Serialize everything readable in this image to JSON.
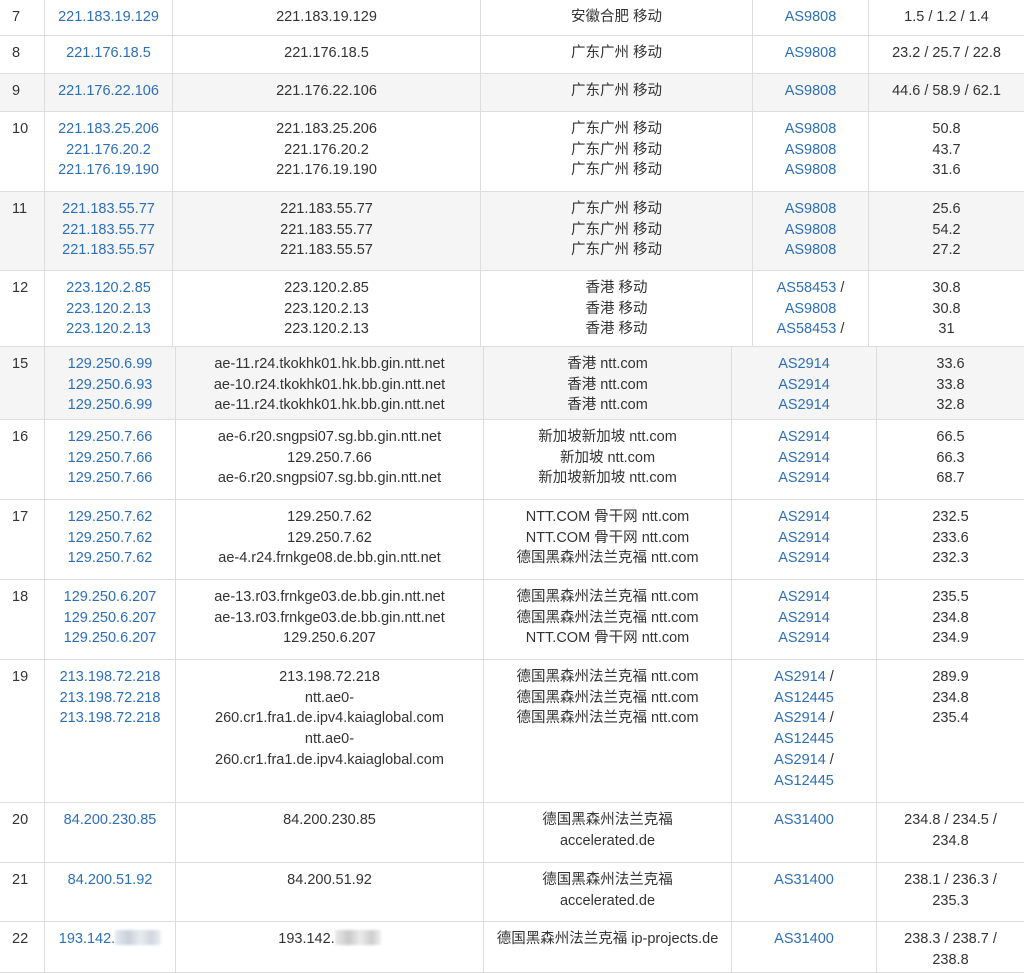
{
  "rows": [
    {
      "hop": "7",
      "ips": [
        "221.183.19.129"
      ],
      "hosts": [
        "221.183.19.129"
      ],
      "locs": [
        "安徽合肥 移动"
      ],
      "asns": [
        {
          "as": "AS9808",
          "sep": ""
        }
      ],
      "rtt": [
        "1.5 / 1.2 / 1.4"
      ]
    },
    {
      "hop": "8",
      "ips": [
        "221.176.18.5"
      ],
      "hosts": [
        "221.176.18.5"
      ],
      "locs": [
        "广东广州 移动"
      ],
      "asns": [
        {
          "as": "AS9808",
          "sep": ""
        }
      ],
      "rtt": [
        "23.2 / 25.7 / 22.8"
      ]
    },
    {
      "hop": "9",
      "ips": [
        "221.176.22.106"
      ],
      "hosts": [
        "221.176.22.106"
      ],
      "locs": [
        "广东广州 移动"
      ],
      "asns": [
        {
          "as": "AS9808",
          "sep": ""
        }
      ],
      "rtt": [
        "44.6 / 58.9 / 62.1"
      ]
    },
    {
      "hop": "10",
      "ips": [
        "221.183.25.206",
        "221.176.20.2",
        "221.176.19.190"
      ],
      "hosts": [
        "221.183.25.206",
        "221.176.20.2",
        "221.176.19.190"
      ],
      "locs": [
        "广东广州 移动",
        "广东广州 移动",
        "广东广州 移动"
      ],
      "asns": [
        {
          "as": "AS9808",
          "sep": ""
        },
        {
          "as": "AS9808",
          "sep": ""
        },
        {
          "as": "AS9808",
          "sep": ""
        }
      ],
      "rtt": [
        "50.8",
        "43.7",
        "31.6"
      ]
    },
    {
      "hop": "11",
      "ips": [
        "221.183.55.77",
        "221.183.55.77",
        "221.183.55.57"
      ],
      "hosts": [
        "221.183.55.77",
        "221.183.55.77",
        "221.183.55.57"
      ],
      "locs": [
        "广东广州 移动",
        "广东广州 移动",
        "广东广州 移动"
      ],
      "asns": [
        {
          "as": "AS9808",
          "sep": ""
        },
        {
          "as": "AS9808",
          "sep": ""
        },
        {
          "as": "AS9808",
          "sep": ""
        }
      ],
      "rtt": [
        "25.6",
        "54.2",
        "27.2"
      ]
    },
    {
      "hop": "12",
      "ips": [
        "223.120.2.85",
        "223.120.2.13",
        "223.120.2.13"
      ],
      "hosts": [
        "223.120.2.85",
        "223.120.2.13",
        "223.120.2.13"
      ],
      "locs": [
        "香港 移动",
        "香港 移动",
        "香港 移动"
      ],
      "asns": [
        {
          "as": "AS58453",
          "sep": " /"
        },
        {
          "as": "AS9808",
          "sep": ""
        },
        {
          "as": "AS58453",
          "sep": " /"
        }
      ],
      "rtt": [
        "30.8",
        "30.8",
        "31"
      ]
    },
    {
      "hop": "15",
      "ips": [
        "129.250.6.99",
        "129.250.6.93",
        "129.250.6.99"
      ],
      "hosts": [
        "ae-11.r24.tkokhk01.hk.bb.gin.ntt.net",
        "ae-10.r24.tkokhk01.hk.bb.gin.ntt.net",
        "ae-11.r24.tkokhk01.hk.bb.gin.ntt.net"
      ],
      "locs": [
        "香港 ntt.com",
        "香港 ntt.com",
        "香港 ntt.com"
      ],
      "asns": [
        {
          "as": "AS2914",
          "sep": ""
        },
        {
          "as": "AS2914",
          "sep": ""
        },
        {
          "as": "AS2914",
          "sep": ""
        }
      ],
      "rtt": [
        "33.6",
        "33.8",
        "32.8"
      ]
    },
    {
      "hop": "16",
      "ips": [
        "129.250.7.66",
        "129.250.7.66",
        "129.250.7.66"
      ],
      "hosts": [
        "ae-6.r20.sngpsi07.sg.bb.gin.ntt.net",
        "129.250.7.66",
        "ae-6.r20.sngpsi07.sg.bb.gin.ntt.net"
      ],
      "locs": [
        "新加坡新加坡 ntt.com",
        "新加坡 ntt.com",
        "新加坡新加坡 ntt.com"
      ],
      "asns": [
        {
          "as": "AS2914",
          "sep": ""
        },
        {
          "as": "AS2914",
          "sep": ""
        },
        {
          "as": "AS2914",
          "sep": ""
        }
      ],
      "rtt": [
        "66.5",
        "66.3",
        "68.7"
      ]
    },
    {
      "hop": "17",
      "ips": [
        "129.250.7.62",
        "129.250.7.62",
        "129.250.7.62"
      ],
      "hosts": [
        "129.250.7.62",
        "129.250.7.62",
        "ae-4.r24.frnkge08.de.bb.gin.ntt.net"
      ],
      "locs": [
        "NTT.COM 骨干网 ntt.com",
        "NTT.COM 骨干网 ntt.com",
        "德国黑森州法兰克福 ntt.com"
      ],
      "asns": [
        {
          "as": "AS2914",
          "sep": ""
        },
        {
          "as": "AS2914",
          "sep": ""
        },
        {
          "as": "AS2914",
          "sep": ""
        }
      ],
      "rtt": [
        "232.5",
        "233.6",
        "232.3"
      ]
    },
    {
      "hop": "18",
      "ips": [
        "129.250.6.207",
        "129.250.6.207",
        "129.250.6.207"
      ],
      "hosts": [
        "ae-13.r03.frnkge03.de.bb.gin.ntt.net",
        "ae-13.r03.frnkge03.de.bb.gin.ntt.net",
        "129.250.6.207"
      ],
      "locs": [
        "德国黑森州法兰克福 ntt.com",
        "德国黑森州法兰克福 ntt.com",
        "NTT.COM 骨干网 ntt.com"
      ],
      "asns": [
        {
          "as": "AS2914",
          "sep": ""
        },
        {
          "as": "AS2914",
          "sep": ""
        },
        {
          "as": "AS2914",
          "sep": ""
        }
      ],
      "rtt": [
        "235.5",
        "234.8",
        "234.9"
      ]
    },
    {
      "hop": "19",
      "ips": [
        "213.198.72.218",
        "213.198.72.218",
        "213.198.72.218"
      ],
      "hosts": [
        "213.198.72.218",
        "ntt.ae0-",
        "260.cr1.fra1.de.ipv4.kaiaglobal.com",
        "ntt.ae0-",
        "260.cr1.fra1.de.ipv4.kaiaglobal.com"
      ],
      "locs": [
        "德国黑森州法兰克福 ntt.com",
        "德国黑森州法兰克福 ntt.com",
        "德国黑森州法兰克福 ntt.com"
      ],
      "asns": [
        {
          "as": "AS2914",
          "sep": " /"
        },
        {
          "as": "AS12445",
          "sep": ""
        },
        {
          "as": "AS2914",
          "sep": " /"
        },
        {
          "as": "AS12445",
          "sep": ""
        },
        {
          "as": "AS2914",
          "sep": " /"
        },
        {
          "as": "AS12445",
          "sep": ""
        }
      ],
      "rtt": [
        "289.9",
        "234.8",
        "235.4"
      ]
    },
    {
      "hop": "20",
      "ips": [
        "84.200.230.85"
      ],
      "hosts": [
        "84.200.230.85"
      ],
      "locs": [
        "德国黑森州法兰克福",
        "accelerated.de"
      ],
      "asns": [
        {
          "as": "AS31400",
          "sep": ""
        }
      ],
      "rtt": [
        "234.8 / 234.5 /",
        "234.8"
      ]
    },
    {
      "hop": "21",
      "ips": [
        "84.200.51.92"
      ],
      "hosts": [
        "84.200.51.92"
      ],
      "locs": [
        "德国黑森州法兰克福",
        "accelerated.de"
      ],
      "asns": [
        {
          "as": "AS31400",
          "sep": ""
        }
      ],
      "rtt": [
        "238.1 / 236.3 /",
        "235.3"
      ]
    },
    {
      "hop": "22",
      "ips": [
        "193.142."
      ],
      "hosts": [
        "193.142."
      ],
      "locs": [
        "德国黑森州法兰克福 ip-projects.de"
      ],
      "asns": [
        {
          "as": "AS31400",
          "sep": ""
        }
      ],
      "rtt": [
        "238.3 / 238.7 /",
        "238.8"
      ]
    }
  ]
}
